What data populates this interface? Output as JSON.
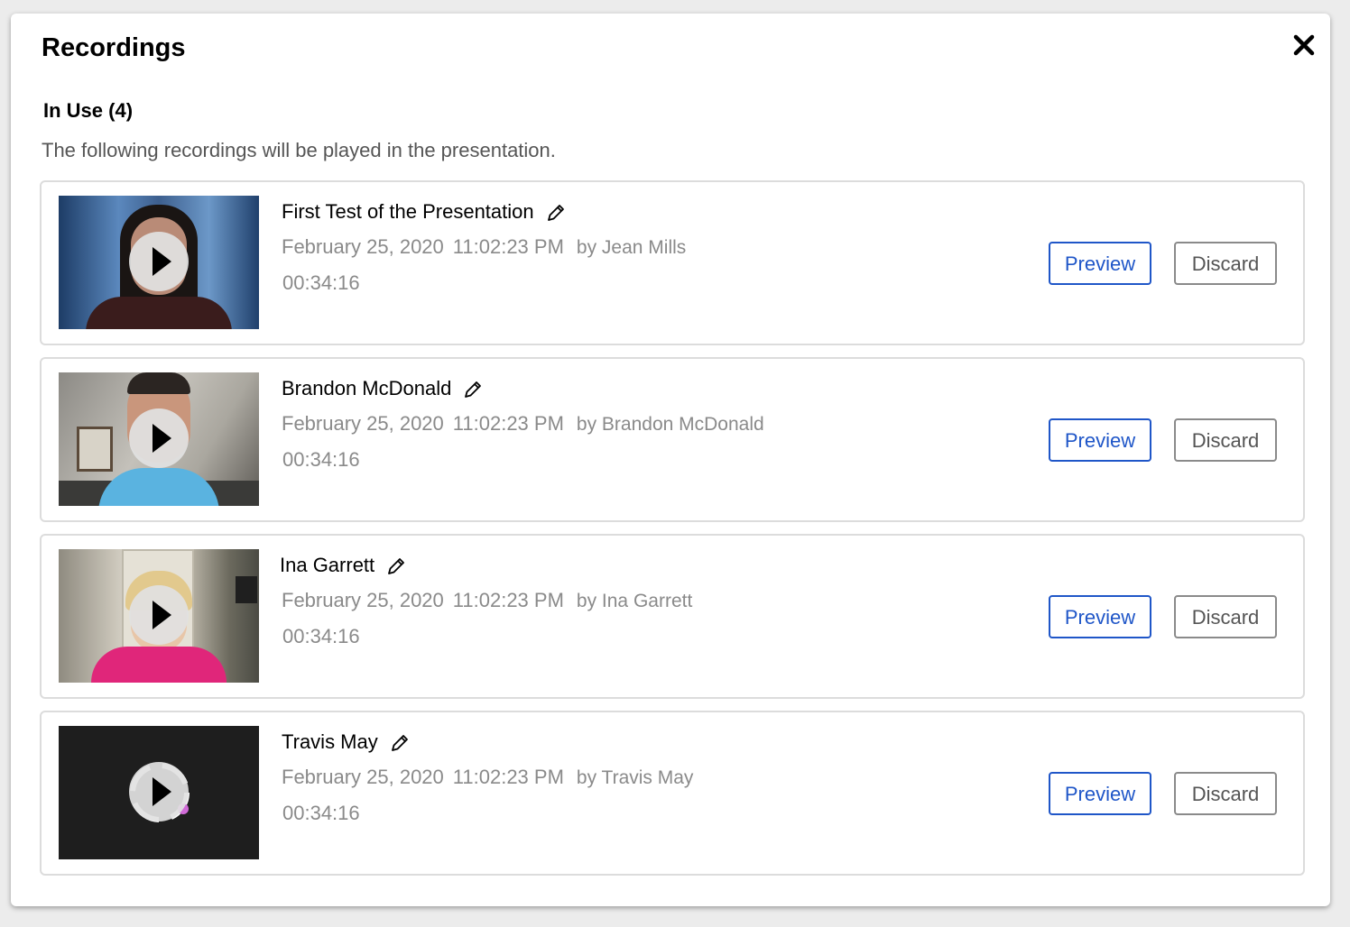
{
  "dialog": {
    "title": "Recordings",
    "section_title": "In Use (4)",
    "description": "The following recordings will be played in the presentation."
  },
  "recordings": [
    {
      "title": "First Test of the Presentation",
      "date": "February 25, 2020",
      "time": "11:02:23 PM",
      "author": "by Jean Mills",
      "duration": "00:34:16",
      "preview_label": "Preview",
      "discard_label": "Discard"
    },
    {
      "title": "Brandon McDonald",
      "date": "February 25, 2020",
      "time": "11:02:23 PM",
      "author": "by Brandon McDonald",
      "duration": "00:34:16",
      "preview_label": "Preview",
      "discard_label": "Discard"
    },
    {
      "title": "Ina Garrett",
      "date": "February 25, 2020",
      "time": "11:02:23 PM",
      "author": "by Ina Garrett",
      "duration": "00:34:16",
      "preview_label": "Preview",
      "discard_label": "Discard"
    },
    {
      "title": "Travis May",
      "date": "February 25, 2020",
      "time": "11:02:23 PM",
      "author": "by Travis May",
      "duration": "00:34:16",
      "preview_label": "Preview",
      "discard_label": "Discard"
    }
  ],
  "colors": {
    "accent": "#1f56c8",
    "muted_text": "#8a8a8a",
    "card_border": "#dcdcdc"
  },
  "icons": {
    "close": "close-icon",
    "edit": "pencil-icon",
    "play": "play-icon"
  }
}
